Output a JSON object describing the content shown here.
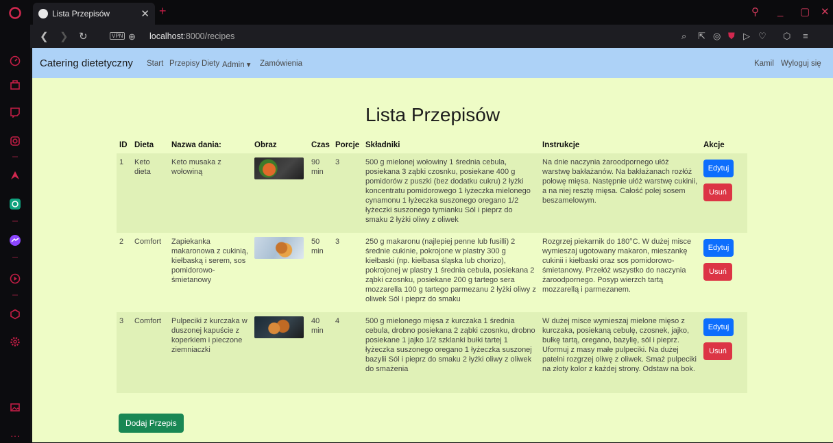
{
  "browser": {
    "tab_title": "Lista Przepisów",
    "vpn_label": "VPN",
    "url_host": "localhost",
    "url_path": ":8000/recipes",
    "accent": "#c41e46"
  },
  "navbar": {
    "brand": "Catering dietetyczny",
    "links": [
      "Start",
      "Przepisy",
      "Diety",
      "Admin ▾",
      "Zamówienia"
    ],
    "user": "Kamil",
    "logout": "Wyloguj się",
    "bg": "#add2f7"
  },
  "page": {
    "title": "Lista Przepisów",
    "bg": "#eefcc6",
    "add_button": "Dodaj Przepis"
  },
  "table": {
    "headers": [
      "ID",
      "Dieta",
      "Nazwa dania:",
      "Obraz",
      "Czas",
      "Porcje",
      "Składniki",
      "Instrukcje",
      "Akcje"
    ],
    "rows": [
      {
        "id": "1",
        "diet": "Keto dieta",
        "name": "Keto musaka z wołowiną",
        "image": "dish-photo-musaka",
        "time": "90 min",
        "portions": "3",
        "ingredients": "500 g mielonej wołowiny 1 średnia cebula, posiekana 3 ząbki czosnku, posiekane 400 g pomidorów z puszki (bez dodatku cukru) 2 łyżki koncentratu pomidorowego 1 łyżeczka mielonego cynamonu 1 łyżeczka suszonego oregano 1/2 łyżeczki suszonego tymianku Sól i pieprz do smaku 2 łyżki oliwy z oliwek",
        "instructions": "Na dnie naczynia żaroodpornego ułóż warstwę bakłażanów. Na bakłażanach rozłóż połowę mięsa. Następnie ułóż warstwę cukinii, a na niej resztę mięsa. Całość polej sosem beszamelowym.",
        "edit": "Edytuj",
        "delete": "Usuń"
      },
      {
        "id": "2",
        "diet": "Comfort",
        "name": "Zapiekanka makaronowa z cukinią, kiełbaską i serem, sos pomidorowo-śmietanowy",
        "image": "dish-photo-zapiekanka",
        "time": "50 min",
        "portions": "3",
        "ingredients": "250 g makaronu (najlepiej penne lub fusilli) 2 średnie cukinie, pokrojone w plastry 300 g kiełbaski (np. kiełbasa śląska lub chorizo), pokrojonej w plastry 1 średnia cebula, posiekana 2 ząbki czosnku, posiekane 200 g tartego sera mozzarella 100 g tartego parmezanu 2 łyżki oliwy z oliwek Sól i pieprz do smaku",
        "instructions": "Rozgrzej piekarnik do 180°C. W dużej misce wymieszaj ugotowany makaron, mieszankę cukinii i kiełbaski oraz sos pomidorowo-śmietanowy. Przełóż wszystko do naczynia żaroodpornego. Posyp wierzch tartą mozzarellą i parmezanem.",
        "edit": "Edytuj",
        "delete": "Usuń"
      },
      {
        "id": "3",
        "diet": "Comfort",
        "name": "Pulpeciki z kurczaka w duszonej kapuście z koperkiem i pieczone ziemniaczki",
        "image": "dish-photo-pulpeciki",
        "time": "40 min",
        "portions": "4",
        "ingredients": "500 g mielonego mięsa z kurczaka 1 średnia cebula, drobno posiekana 2 ząbki czosnku, drobno posiekane 1 jajko 1/2 szklanki bułki tartej 1 łyżeczka suszonego oregano 1 łyżeczka suszonej bazylii Sól i pieprz do smaku 2 łyżki oliwy z oliwek do smażenia",
        "instructions": "W dużej misce wymieszaj mielone mięso z kurczaka, posiekaną cebulę, czosnek, jajko, bułkę tartą, oregano, bazylię, sól i pieprz. Uformuj z masy małe pulpeciki. Na dużej patelni rozgrzej oliwę z oliwek. Smaż pulpeciki na złoty kolor z każdej strony. Odstaw na bok.",
        "edit": "Edytuj",
        "delete": "Usuń"
      }
    ]
  },
  "colors": {
    "edit_button": "#0d6efd",
    "delete_button": "#dc3545",
    "add_button": "#198754"
  }
}
